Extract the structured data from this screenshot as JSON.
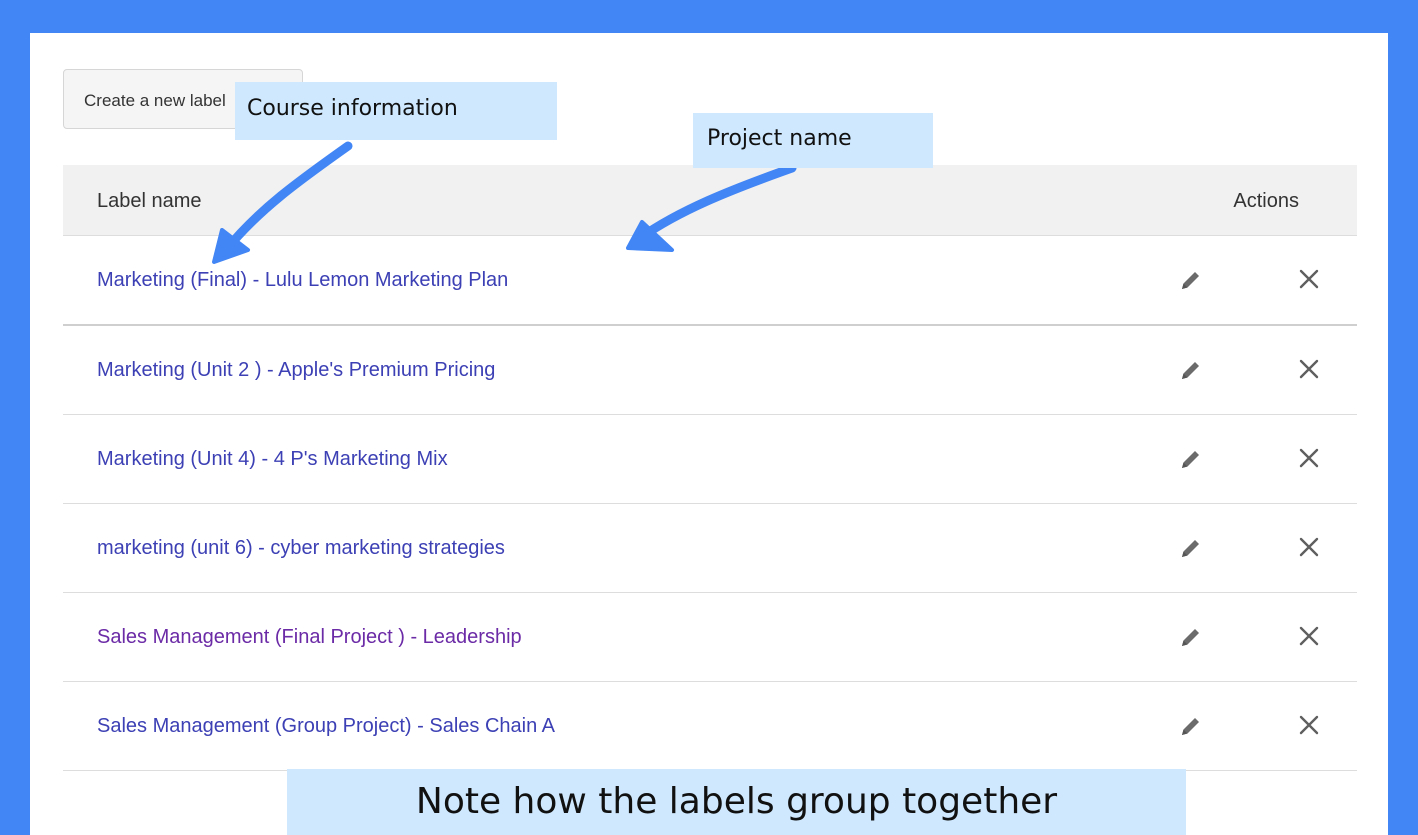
{
  "toolbar": {
    "create_label": "Create a new label"
  },
  "table": {
    "columns": {
      "label": "Label name",
      "actions": "Actions"
    },
    "rows": [
      {
        "label": "Marketing (Final) - Lulu Lemon Marketing Plan"
      },
      {
        "label": "Marketing (Unit 2 ) - Apple's Premium Pricing"
      },
      {
        "label": "Marketing (Unit 4) - 4 P's Marketing Mix"
      },
      {
        "label": "marketing (unit 6) - cyber marketing strategies"
      },
      {
        "label": "Sales Management (Final Project ) - Leadership"
      },
      {
        "label": "Sales Management (Group Project) - Sales Chain A"
      }
    ]
  },
  "annotations": {
    "course_information": "Course information",
    "project_name": "Project name",
    "note": "Note how the labels group together"
  },
  "colors": {
    "frame": "#4285f4",
    "callout": "#cfe8fd",
    "link": "#3c40b4",
    "visited_link": "#6b2aa6",
    "arrow": "#4285f4"
  },
  "icons": {
    "edit": "pencil-icon",
    "delete": "close-icon"
  }
}
